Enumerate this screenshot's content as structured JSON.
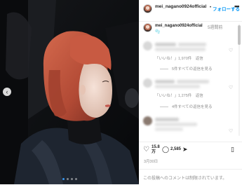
{
  "post": {
    "carousel": {
      "slide_count": 4,
      "current_slide": 1
    }
  },
  "header": {
    "username": "mei_nagano0924official",
    "follow_label": "フォローする",
    "more_icon": "more-dots-icon"
  },
  "caption": {
    "username": "mei_nagano0924official",
    "time": "5週間前",
    "text": "🫧"
  },
  "comments": [
    {
      "likes": "「いいね！」1,970件",
      "reply": "返信",
      "view_replies": "5件すべての返信を見る"
    },
    {
      "likes": "「いいね！」1,275件",
      "reply": "返信",
      "view_replies": "4件すべての返信を見る"
    },
    {
      "likes": "",
      "reply": "",
      "view_replies": ""
    }
  ],
  "actions": {
    "likes_count": "15.8万",
    "comments_count": "2,585",
    "icons": [
      "heart-icon",
      "comment-icon",
      "share-icon",
      "bookmark-icon"
    ]
  },
  "date": "3月30日",
  "footer": {
    "notice": "この投稿へのコメントは制限されています。"
  },
  "colors": {
    "accent": "#0095f6",
    "muted": "#8e8e8e",
    "text": "#262626",
    "photo_bg": "#0c0d10",
    "hair": "#c0553e"
  }
}
